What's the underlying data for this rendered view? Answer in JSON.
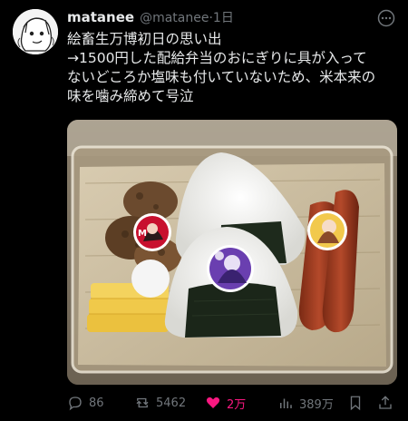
{
  "user": {
    "display_name": "matanee",
    "handle": "@matanee",
    "separator": "·",
    "time": "1日",
    "avatar_icon": "manga-sketch-avatar"
  },
  "tweet": {
    "lines": [
      "絵畜生万博初日の思い出",
      "→1500円した配給弁当のおにぎりに具が入って",
      "ないどころか塩味も付いていないため、米本来の",
      "味を噛み締めて号泣"
    ]
  },
  "media": {
    "description_icon": "bento-box-photo",
    "sticker_colors": [
      "#c8102e",
      "#6a3fb0",
      "#f2c94c",
      "#ffffff"
    ]
  },
  "actions": {
    "replies": "86",
    "retweets": "5462",
    "likes": "2万",
    "views": "389万"
  },
  "colors": {
    "like_active": "#f91880",
    "muted": "#71767b",
    "text": "#e7e9ea"
  }
}
